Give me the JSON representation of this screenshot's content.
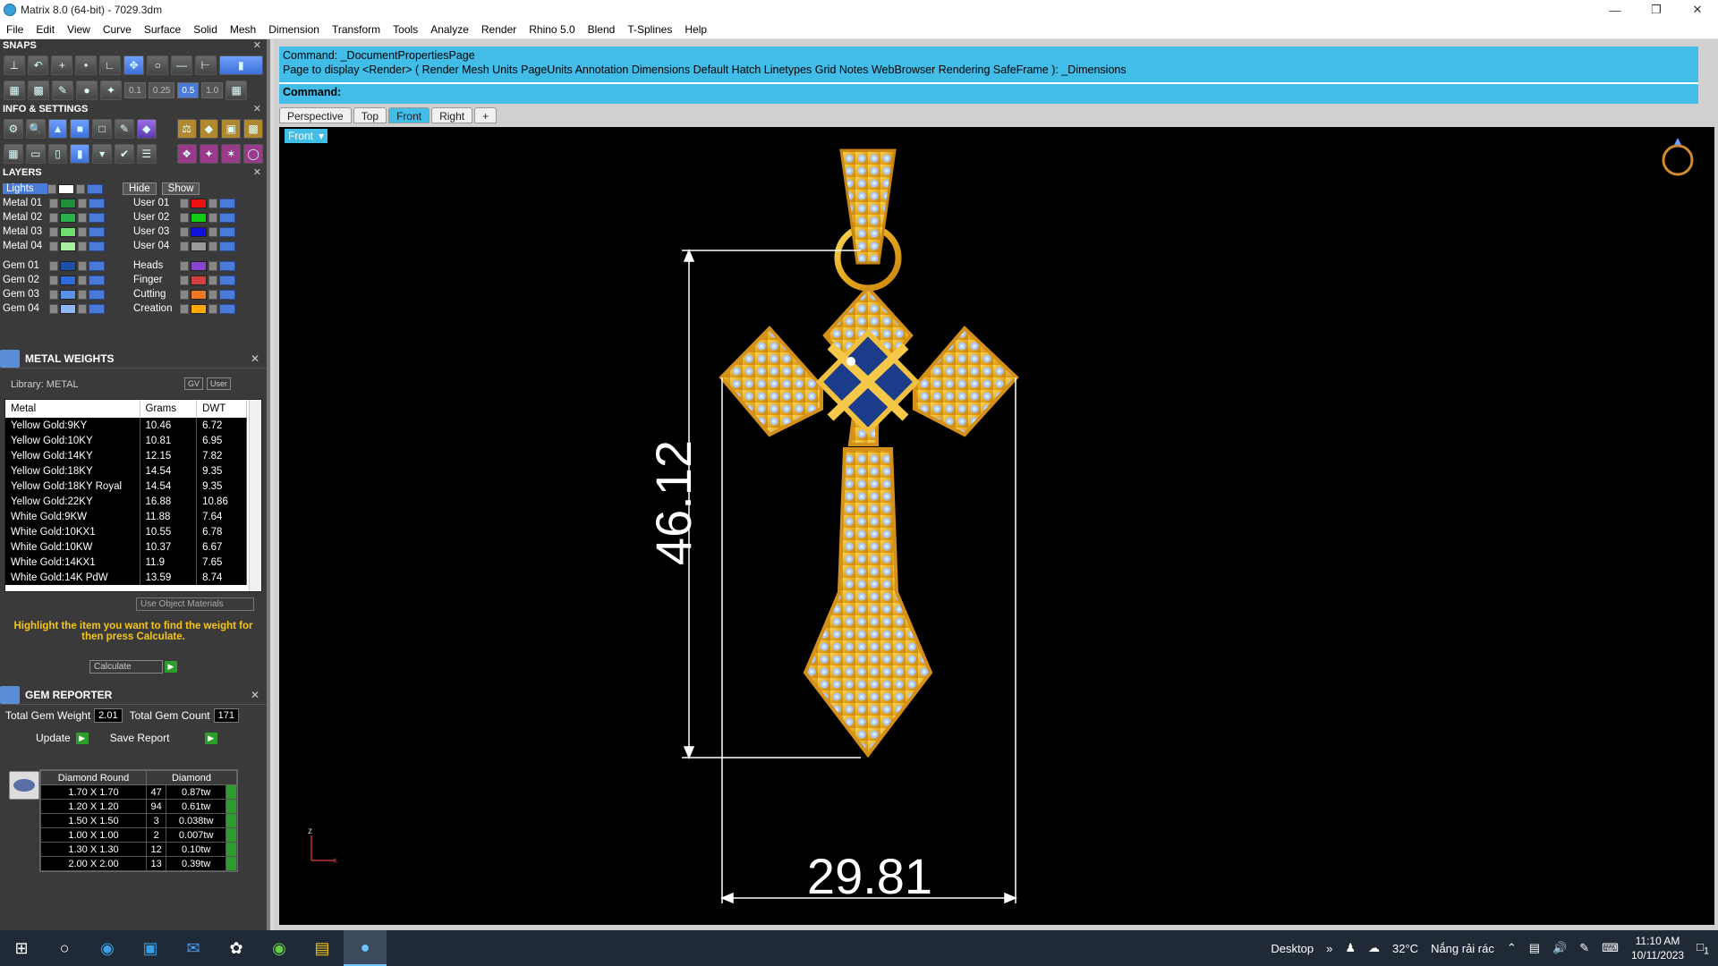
{
  "window": {
    "title": "Matrix 8.0 (64-bit) - 7029.3dm"
  },
  "menu": [
    "File",
    "Edit",
    "View",
    "Curve",
    "Surface",
    "Solid",
    "Mesh",
    "Dimension",
    "Transform",
    "Tools",
    "Analyze",
    "Render",
    "Rhino 5.0",
    "Blend",
    "T-Splines",
    "Help"
  ],
  "snaps": {
    "title": "SNAPS",
    "values": [
      "0.1",
      "0.25",
      "0.5",
      "1.0"
    ]
  },
  "info": {
    "title": "INFO & SETTINGS"
  },
  "layers": {
    "title": "LAYERS",
    "lights": "Lights",
    "hide": "Hide",
    "show": "Show",
    "left": [
      {
        "name": "Metal 01",
        "color": "#1f8f3c"
      },
      {
        "name": "Metal 02",
        "color": "#28b04a"
      },
      {
        "name": "Metal 03",
        "color": "#6fe06f"
      },
      {
        "name": "Metal 04",
        "color": "#a8f0a0"
      },
      {
        "name": "Gem 01",
        "color": "#1e4fa8"
      },
      {
        "name": "Gem 02",
        "color": "#2e6ad8"
      },
      {
        "name": "Gem 03",
        "color": "#5a90e8"
      },
      {
        "name": "Gem 04",
        "color": "#8fb8f5"
      }
    ],
    "right": [
      {
        "name": "User 01",
        "color": "#ee1111"
      },
      {
        "name": "User 02",
        "color": "#11cc11"
      },
      {
        "name": "User 03",
        "color": "#1111dd"
      },
      {
        "name": "User 04",
        "color": "#999999"
      },
      {
        "name": "Heads",
        "color": "#8844cc"
      },
      {
        "name": "Finger",
        "color": "#d04040"
      },
      {
        "name": "Cutting",
        "color": "#ee7722"
      },
      {
        "name": "Creation",
        "color": "#ffaa00"
      }
    ]
  },
  "metal_weights": {
    "title": "METAL WEIGHTS",
    "library": "Library: METAL",
    "gv": "GV",
    "user": "User",
    "columns": [
      "Metal",
      "Grams",
      "DWT"
    ],
    "rows": [
      [
        "Yellow Gold:9KY",
        "10.46",
        "6.72"
      ],
      [
        "Yellow Gold:10KY",
        "10.81",
        "6.95"
      ],
      [
        "Yellow Gold:14KY",
        "12.15",
        "7.82"
      ],
      [
        "Yellow Gold:18KY",
        "14.54",
        "9.35"
      ],
      [
        "Yellow Gold:18KY Royal",
        "14.54",
        "9.35"
      ],
      [
        "Yellow Gold:22KY",
        "16.88",
        "10.86"
      ],
      [
        "White Gold:9KW",
        "11.88",
        "7.64"
      ],
      [
        "White Gold:10KX1",
        "10.55",
        "6.78"
      ],
      [
        "White Gold:10KW",
        "10.37",
        "6.67"
      ],
      [
        "White Gold:14KX1",
        "11.9",
        "7.65"
      ],
      [
        "White Gold:14K PdW",
        "13.59",
        "8.74"
      ]
    ],
    "use_object_materials": "Use Object Materials",
    "hint": "Highlight the item you want to find the weight for then press Calculate.",
    "calculate": "Calculate"
  },
  "gem_reporter": {
    "title": "GEM REPORTER",
    "total_weight_label": "Total Gem Weight",
    "total_weight": "2.01",
    "total_count_label": "Total Gem Count",
    "total_count": "171",
    "update": "Update",
    "save_report": "Save Report",
    "columns": [
      "Diamond Round",
      "Diamond"
    ],
    "rows": [
      [
        "1.70 X 1.70",
        "47",
        "0.87tw"
      ],
      [
        "1.20 X 1.20",
        "94",
        "0.61tw"
      ],
      [
        "1.50 X 1.50",
        "3",
        "0.038tw"
      ],
      [
        "1.00 X 1.00",
        "2",
        "0.007tw"
      ],
      [
        "1.30 X 1.30",
        "12",
        "0.10tw"
      ],
      [
        "2.00 X 2.00",
        "13",
        "0.39tw"
      ]
    ]
  },
  "command": {
    "line1": "Command: _DocumentPropertiesPage",
    "line2": "Page to display <Render> ( Render  Mesh  Units  PageUnits  Annotation  Dimensions  Default  Hatch  Linetypes  Grid  Notes  WebBrowser  Rendering  SafeFrame ): _Dimensions",
    "prompt": "Command:"
  },
  "viewport_tabs": [
    "Perspective",
    "Top",
    "Front",
    "Right",
    "+"
  ],
  "active_tab": "Front",
  "viewport": {
    "label": "Front",
    "dim_height": "46.12",
    "dim_width": "29.81",
    "axis_z": "z",
    "axis_x": "x"
  },
  "taskbar": {
    "desktop": "Desktop",
    "temp": "32°C",
    "weather": "Nắng rải rác",
    "time": "11:10 AM",
    "date": "10/11/2023",
    "notif": "1"
  }
}
